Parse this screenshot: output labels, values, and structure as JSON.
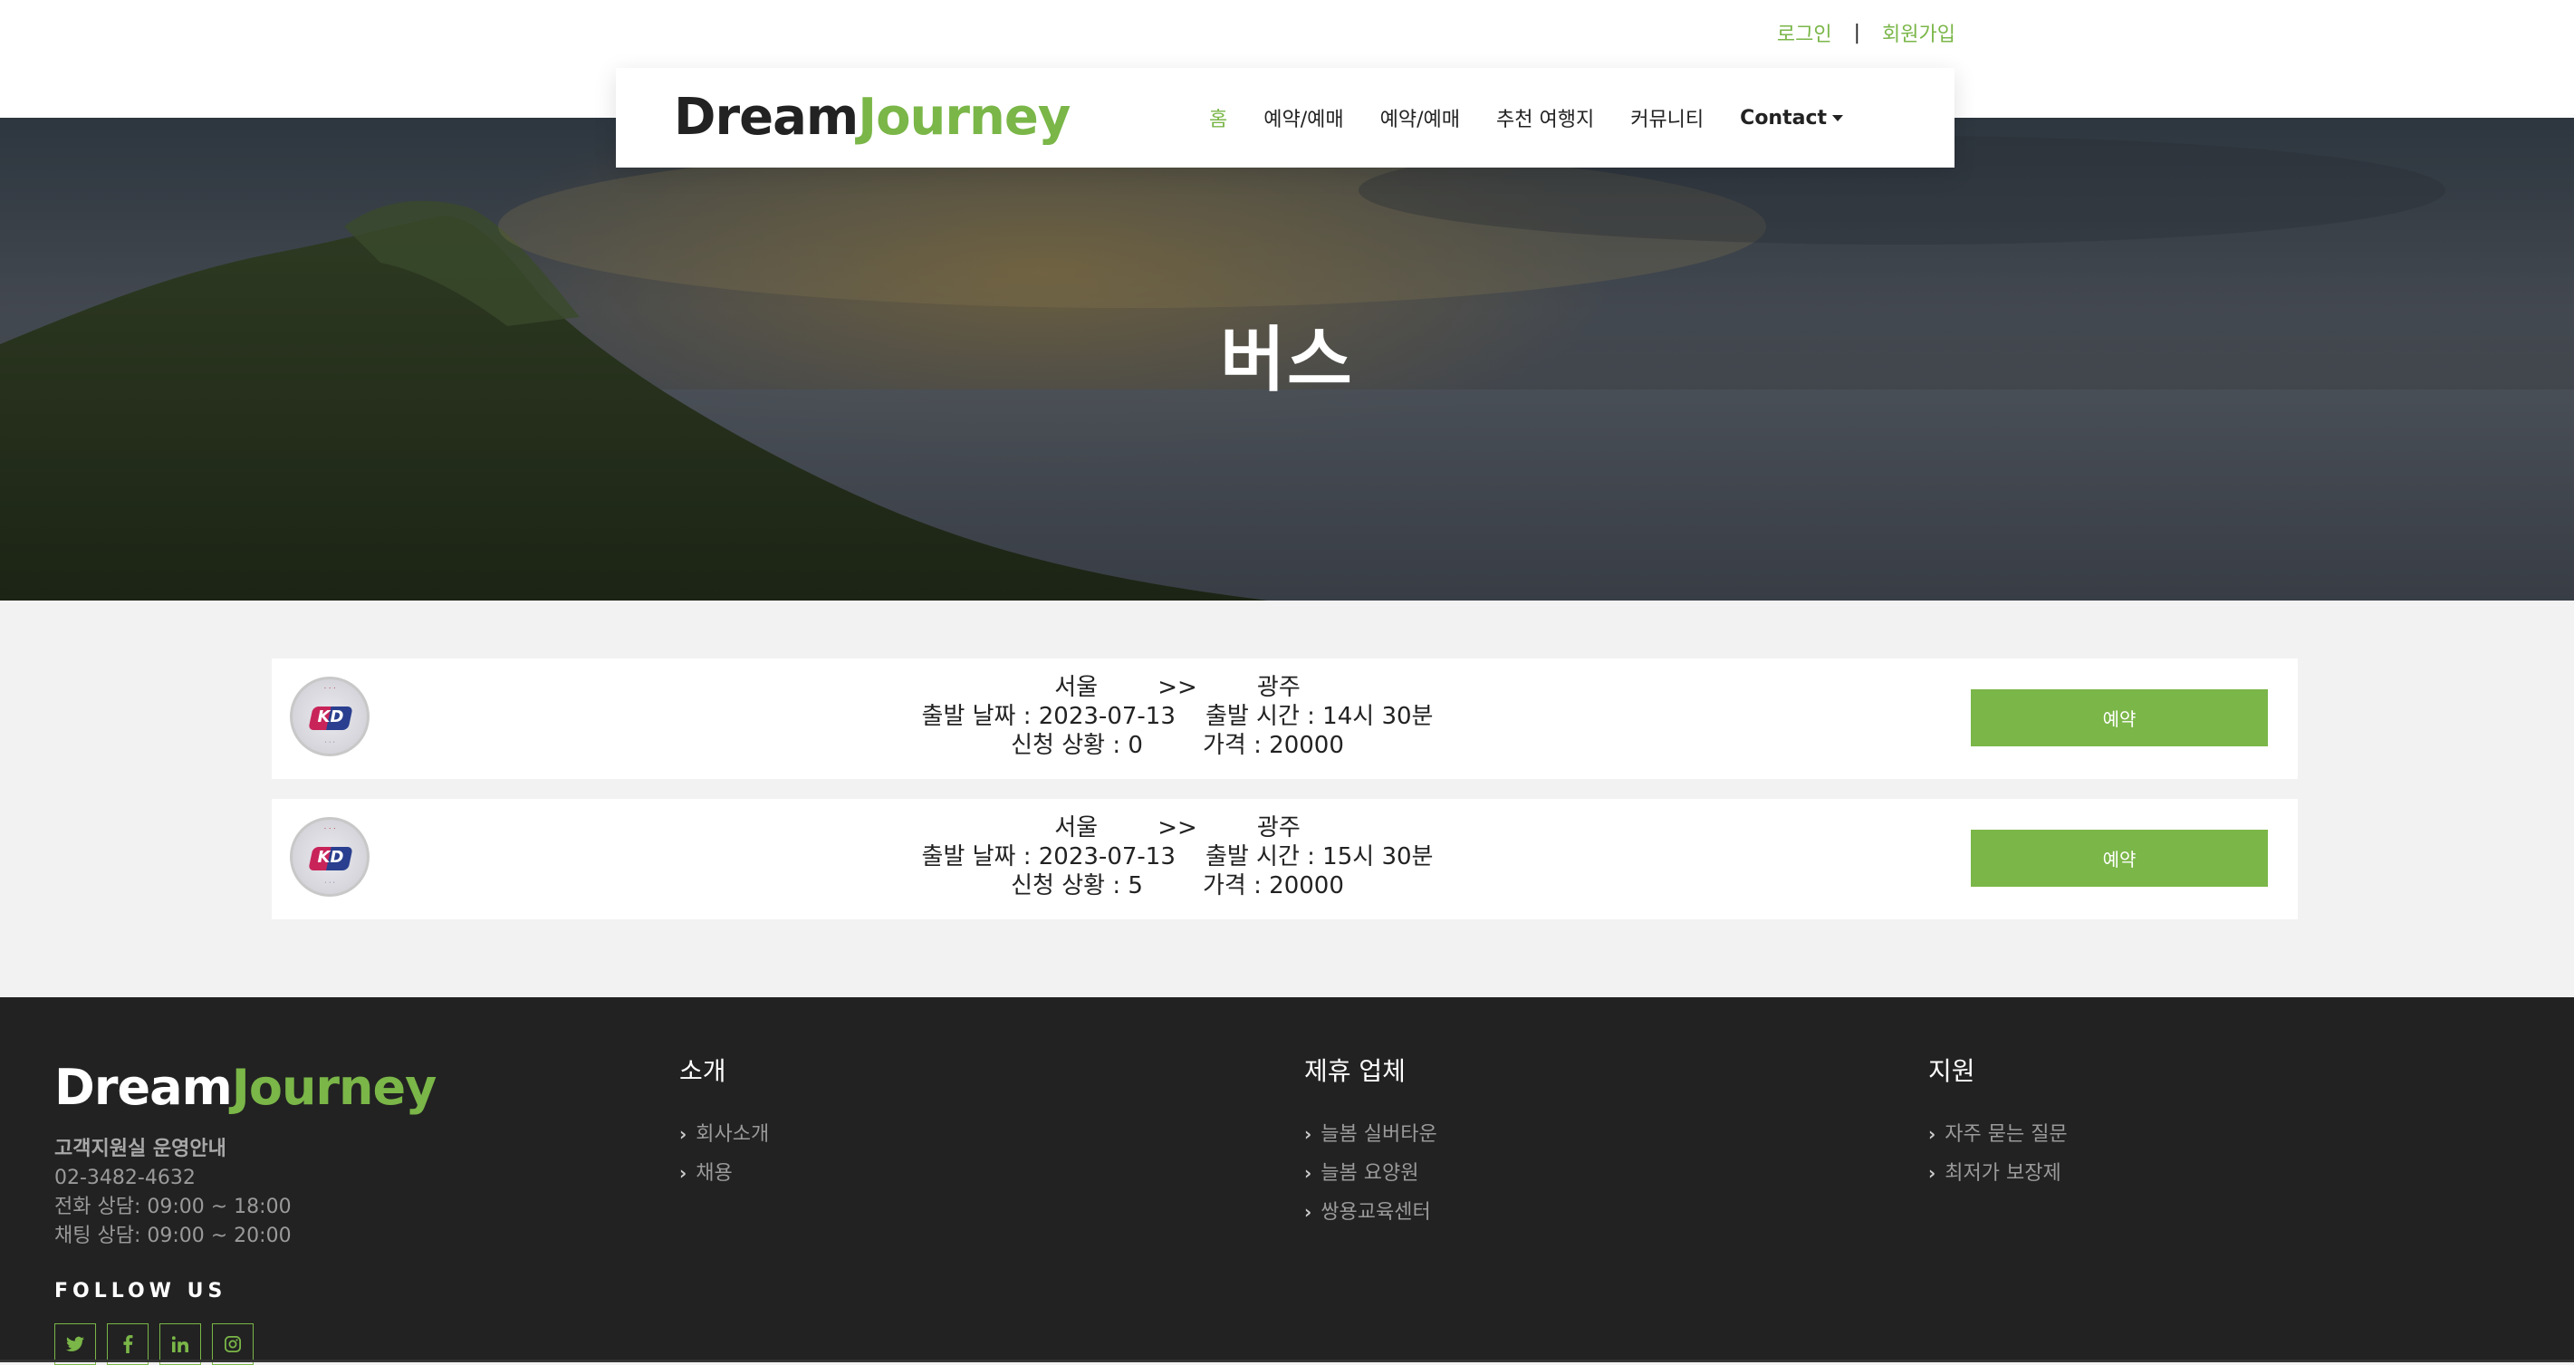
{
  "top_links": {
    "login": "로그인",
    "separator": "|",
    "signup": "회원가입"
  },
  "brand": {
    "part1": "Dream",
    "part2": "Journey"
  },
  "nav": {
    "items": [
      "홈",
      "예약/예매",
      "예약/예매",
      "추천 여행지",
      "커뮤니티"
    ],
    "contact": "Contact"
  },
  "hero": {
    "title": "버스"
  },
  "buses": [
    {
      "from": "서울",
      "arrow": ">>",
      "to": "광주",
      "date_label": "출발 날짜 : ",
      "date": "2023-07-13",
      "time_label": "출발 시간 : ",
      "time": "14시 30분",
      "status_label": "신청 상황 : ",
      "status": "0",
      "price_label": "가격 : ",
      "price": "20000",
      "button": "예약"
    },
    {
      "from": "서울",
      "arrow": ">>",
      "to": "광주",
      "date_label": "출발 날짜 : ",
      "date": "2023-07-13",
      "time_label": "출발 시간 : ",
      "time": "15시 30분",
      "status_label": "신청 상황 : ",
      "status": "5",
      "price_label": "가격 : ",
      "price": "20000",
      "button": "예약"
    }
  ],
  "footer": {
    "brand": {
      "part1": "Dream",
      "part2": "Journey"
    },
    "cs_title": "고객지원실 운영안내",
    "cs_phone": "02-3482-4632",
    "cs_call": "전화 상담: 09:00 ~ 18:00",
    "cs_chat": "채팅 상담: 09:00 ~ 20:00",
    "follow": "FOLLOW US",
    "social_icons": [
      "twitter-icon",
      "facebook-icon",
      "linkedin-icon",
      "instagram-icon"
    ],
    "columns": [
      {
        "title": "소개",
        "items": [
          "회사소개",
          "채용"
        ]
      },
      {
        "title": "제휴 업체",
        "items": [
          "늘봄 실버타운",
          "늘봄 요양원",
          "쌍용교육센터"
        ]
      },
      {
        "title": "지원",
        "items": [
          "자주 묻는 질문",
          "최저가 보장제"
        ]
      }
    ]
  },
  "colors": {
    "accent": "#7ab648",
    "dark": "#222222",
    "page_bg": "#f2f2f2"
  }
}
